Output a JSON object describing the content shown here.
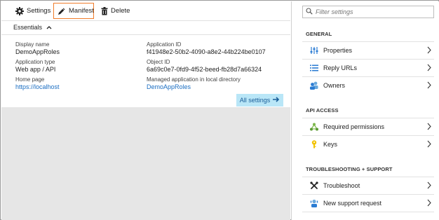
{
  "toolbar": {
    "settings_label": "Settings",
    "manifest_label": "Manifest",
    "delete_label": "Delete"
  },
  "essentials": {
    "toggle_label": "Essentials",
    "display_name_label": "Display name",
    "display_name_value": "DemoAppRoles",
    "app_type_label": "Application type",
    "app_type_value": "Web app / API",
    "home_page_label": "Home page",
    "home_page_value": "https://localhost",
    "app_id_label": "Application ID",
    "app_id_value": "f41948e2-50b2-4090-a8e2-44b224be0107",
    "object_id_label": "Object ID",
    "object_id_value": "6a69c0e7-0fd9-4f52-beed-fb28d7a66324",
    "managed_label": "Managed application in local directory",
    "managed_value": "DemoAppRoles",
    "all_settings_label": "All settings"
  },
  "settings_panel": {
    "filter_placeholder": "Filter settings",
    "sections": [
      {
        "title": "GENERAL",
        "items": [
          {
            "label": "Properties",
            "icon": "properties-icon"
          },
          {
            "label": "Reply URLs",
            "icon": "list-icon"
          },
          {
            "label": "Owners",
            "icon": "users-icon"
          }
        ]
      },
      {
        "title": "API ACCESS",
        "items": [
          {
            "label": "Required permissions",
            "icon": "permissions-icon"
          },
          {
            "label": "Keys",
            "icon": "key-icon"
          }
        ]
      },
      {
        "title": "TROUBLESHOOTING + SUPPORT",
        "items": [
          {
            "label": "Troubleshoot",
            "icon": "wrench-icon"
          },
          {
            "label": "New support request",
            "icon": "support-icon"
          }
        ]
      }
    ]
  },
  "colors": {
    "accent_border": "#f07c2a",
    "link": "#1b6ec2",
    "button_bg": "#b9e6f7"
  }
}
